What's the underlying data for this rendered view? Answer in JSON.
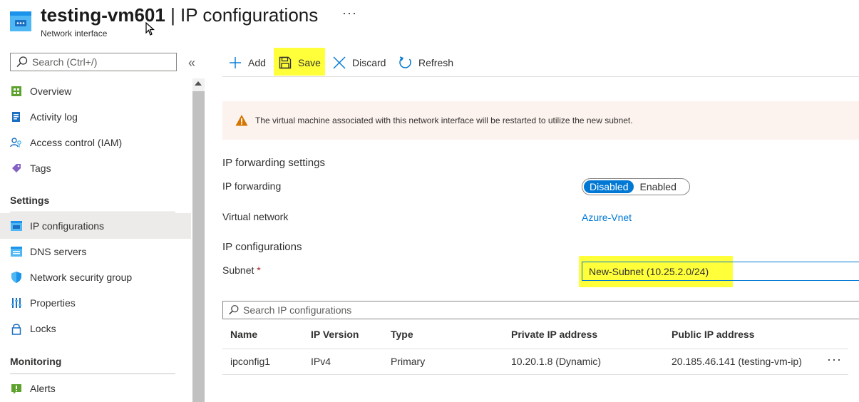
{
  "header": {
    "resource_name": "testing-vm601",
    "separator": " | ",
    "page_name": "IP configurations",
    "subtitle": "Network interface",
    "more": "···",
    "icon": "network-interface-icon"
  },
  "sidebar": {
    "search_placeholder": "Search (Ctrl+/)",
    "collapse": "«",
    "items_top": [
      {
        "label": "Overview",
        "icon": "overview-icon"
      },
      {
        "label": "Activity log",
        "icon": "activity-log-icon"
      },
      {
        "label": "Access control (IAM)",
        "icon": "iam-icon"
      },
      {
        "label": "Tags",
        "icon": "tag-icon"
      }
    ],
    "settings_label": "Settings",
    "items_settings": [
      {
        "label": "IP configurations",
        "icon": "ip-config-icon",
        "selected": true
      },
      {
        "label": "DNS servers",
        "icon": "dns-icon"
      },
      {
        "label": "Network security group",
        "icon": "shield-icon"
      },
      {
        "label": "Properties",
        "icon": "properties-icon"
      },
      {
        "label": "Locks",
        "icon": "lock-icon"
      }
    ],
    "monitoring_label": "Monitoring",
    "items_monitoring": [
      {
        "label": "Alerts",
        "icon": "alerts-icon"
      }
    ]
  },
  "toolbar": {
    "add": "Add",
    "save": "Save",
    "discard": "Discard",
    "refresh": "Refresh"
  },
  "warning": {
    "text": "The virtual machine associated with this network interface will be restarted to utilize the new subnet."
  },
  "form": {
    "ip_forwarding_settings": "IP forwarding settings",
    "ip_forwarding_label": "IP forwarding",
    "toggle_disabled": "Disabled",
    "toggle_enabled": "Enabled",
    "toggle_value": "Disabled",
    "virtual_network_label": "Virtual network",
    "virtual_network_value": "Azure-Vnet",
    "ip_configurations_heading": "IP configurations",
    "subnet_label": "Subnet",
    "subnet_required": "*",
    "subnet_value": "New-Subnet (10.25.2.0/24)"
  },
  "ip_table": {
    "search_placeholder": "Search IP configurations",
    "columns": [
      "Name",
      "IP Version",
      "Type",
      "Private IP address",
      "Public IP address"
    ],
    "rows": [
      [
        "ipconfig1",
        "IPv4",
        "Primary",
        "10.20.1.8 (Dynamic)",
        "20.185.46.141 (testing-vm-ip)"
      ]
    ],
    "row_more": "···"
  },
  "colors": {
    "accent": "#0078d4",
    "highlight": "#ffff3a",
    "warning_bg": "#fdf3ee",
    "warning_icon": "#d47500"
  }
}
